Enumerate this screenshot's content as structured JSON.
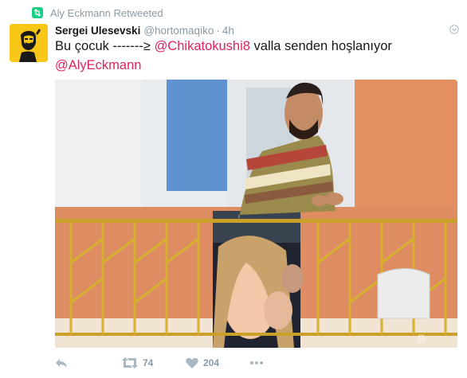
{
  "retweet_context": {
    "text": "Aly Eckmann Retweeted",
    "icon": "retweet-icon",
    "color": "#19cf86"
  },
  "tweet": {
    "author_name": "Sergei Ulesevski",
    "handle": "@hortomaqiko",
    "separator": "·",
    "time": "4h",
    "text_prefix": "Bu çocuk -------≥ ",
    "mention_1": "@Chikatokushi8",
    "text_suffix": " valla senden hoşlanıyor",
    "mention_2": "@AlyEckmann",
    "mention_color": "#e0245e",
    "avatar_color": "#f7c617"
  },
  "actions": {
    "reply_icon": "reply-icon",
    "retweet_icon": "retweet-icon",
    "retweet_count": "74",
    "like_icon": "heart-icon",
    "like_count": "204",
    "more_icon": "more-dots-icon"
  }
}
